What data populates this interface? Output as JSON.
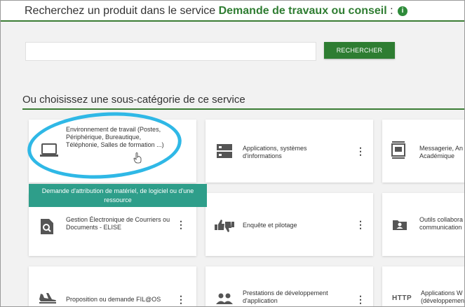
{
  "search": {
    "title_prefix": "Recherchez un produit dans le service ",
    "service_name": "Demande de travaux ou conseil",
    "title_suffix": " : ",
    "info_icon": "i",
    "input_value": "",
    "input_placeholder": "",
    "button_label": "RECHERCHER"
  },
  "subcategories": {
    "heading": "Ou choisissez une sous-catégorie de ce service",
    "cards": [
      {
        "icon": "laptop-icon",
        "label": "Environnement de travail (Postes, Périphérique, Bureautique, Téléphonie, Salles de formation ...)"
      },
      {
        "icon": "server-icon",
        "label": "Applications, systèmes d'informations"
      },
      {
        "icon": "mail-archive-icon",
        "label": "Messagerie, An Académique"
      },
      {
        "icon": "document-search-icon",
        "label": "Gestion Électronique de Courriers ou Documents - ELISE"
      },
      {
        "icon": "thumbs-up-down-icon",
        "label": "Enquête et pilotage"
      },
      {
        "icon": "folder-account-icon",
        "label": "Outils collabora communication"
      },
      {
        "icon": "airplane-icon",
        "label": "Proposition ou demande FIL@OS"
      },
      {
        "icon": "people-icon",
        "label": "Prestations de développement d'application"
      },
      {
        "icon": "http-icon",
        "label": "Applications W (développemen"
      }
    ],
    "more_menu_glyph": "⋮"
  },
  "tooltip": {
    "text": "Demande d'attribution de matériel, de logiciel ou d'une ressource"
  },
  "colors": {
    "accent_green": "#2e7d32",
    "tooltip_teal": "#2e9e8a",
    "highlight_blue": "#2fb8e6"
  }
}
